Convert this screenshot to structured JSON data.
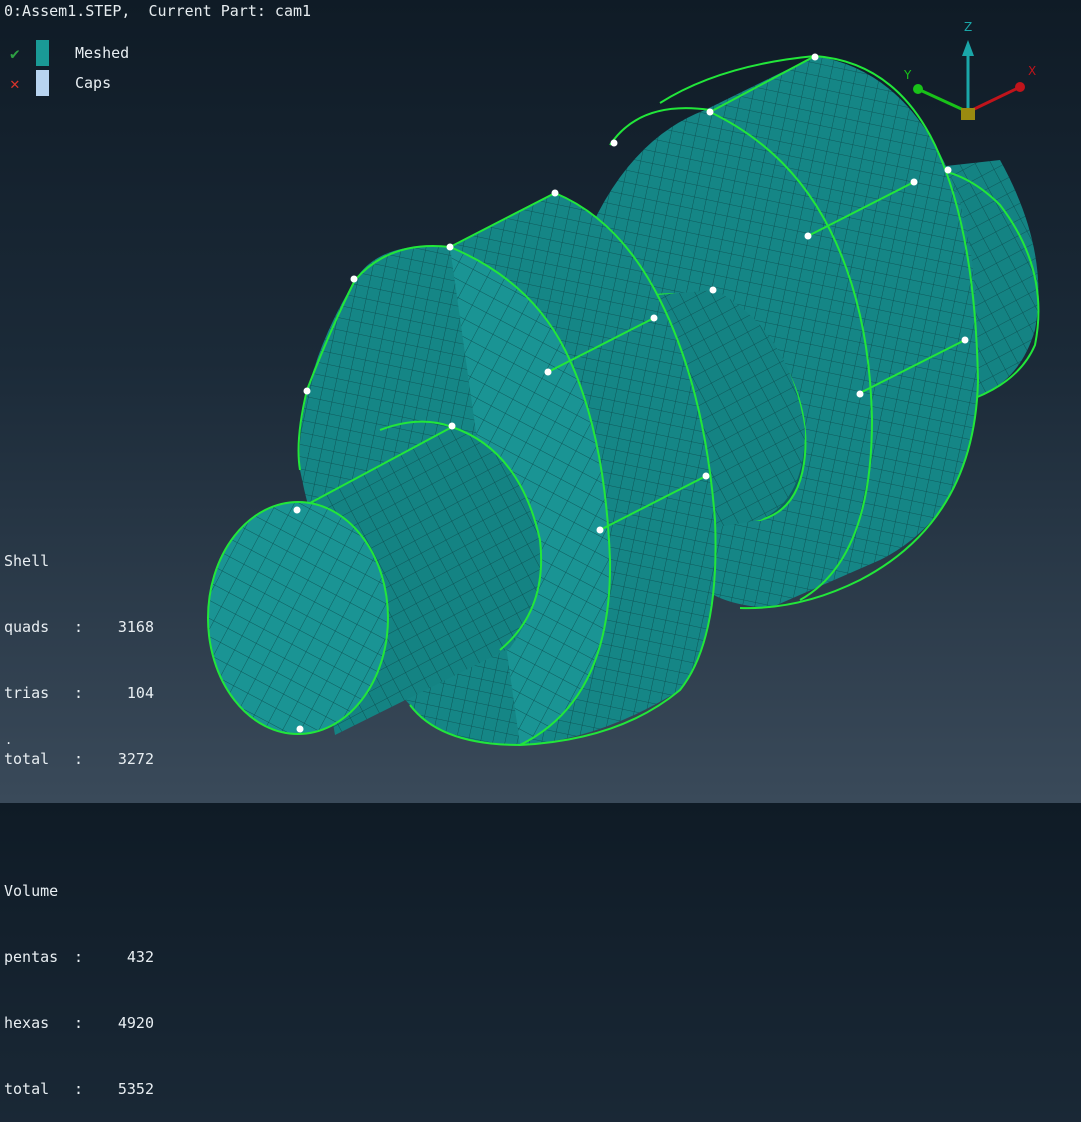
{
  "header": {
    "title": "0:Assem1.STEP,  Current Part: cam1"
  },
  "legend": [
    {
      "mark": "✔",
      "mark_color": "#2ea043",
      "swatch_color": "#1a9a96",
      "label": "Meshed"
    },
    {
      "mark": "✕",
      "mark_color": "#d9342b",
      "swatch_color": "#b8d4f0",
      "label": "Caps"
    }
  ],
  "stats": {
    "shell_heading": "Shell",
    "shell": [
      {
        "name": "quads",
        "value": "3168"
      },
      {
        "name": "trias",
        "value": "104"
      },
      {
        "name": "total",
        "value": "3272"
      }
    ],
    "volume_heading": "Volume",
    "volume": [
      {
        "name": "pentas",
        "value": "432"
      },
      {
        "name": "hexas",
        "value": "4920"
      },
      {
        "name": "total",
        "value": "5352"
      }
    ]
  },
  "footnote": ".",
  "triad": {
    "z_label": "Z",
    "y_label": "Y",
    "x_label": "X",
    "z_color": "#1aa6a8",
    "y_color": "#19c219",
    "x_color": "#c0141b"
  },
  "colors": {
    "mesh_face": "#148383",
    "mesh_face_light": "#1a9494",
    "mesh_face_dark": "#0e5f62",
    "mesh_lines": "#0b4a4c",
    "edge_highlight": "#22e63a"
  }
}
